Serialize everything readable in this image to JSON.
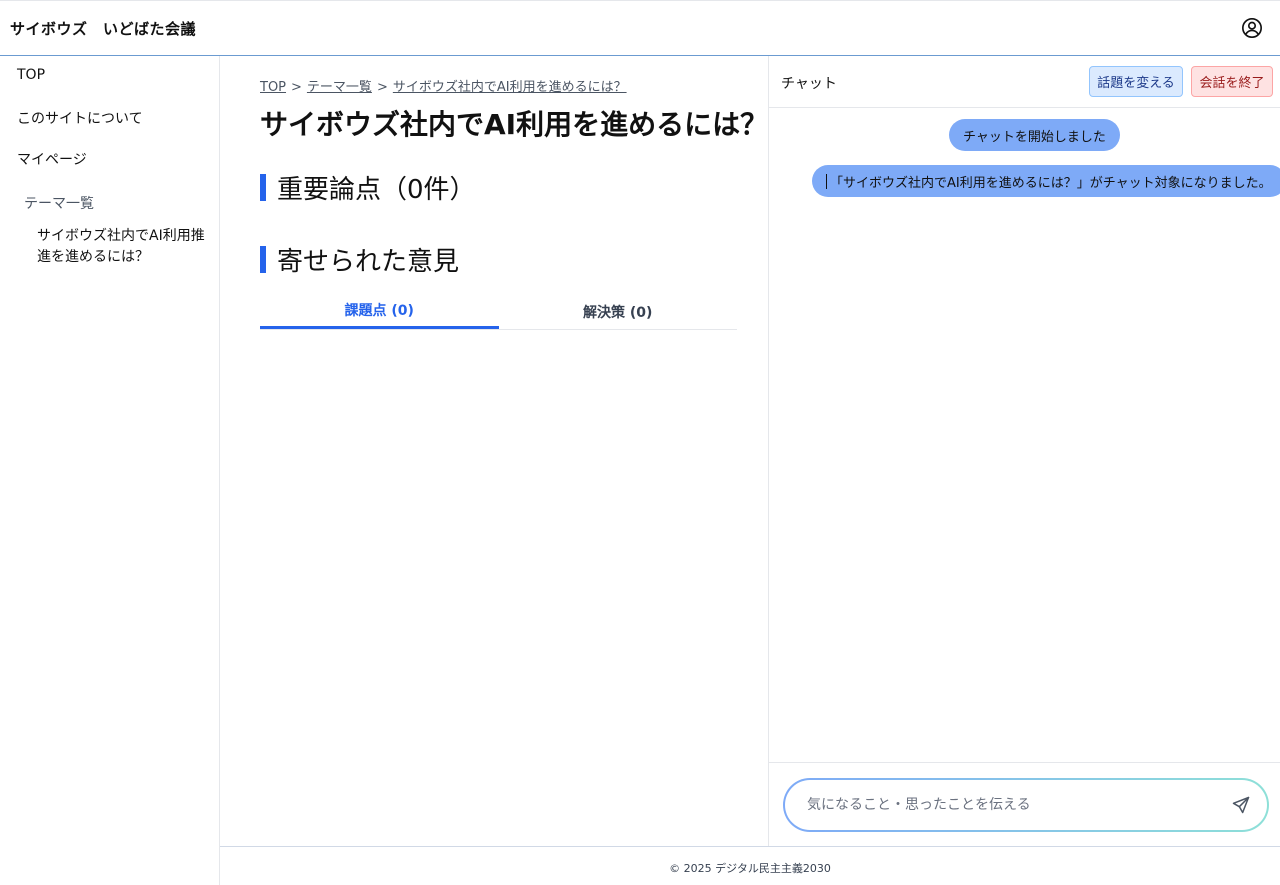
{
  "header": {
    "app_title": "サイボウズ　いどばた会議",
    "account_icon": "user-circle-icon"
  },
  "sidebar": {
    "items": [
      {
        "label": "TOP"
      },
      {
        "label": "このサイトについて"
      },
      {
        "label": "マイページ"
      }
    ],
    "section_label": "テーマ一覧",
    "theme_item": "サイボウズ社内でAI利用推進を進めるには？"
  },
  "main": {
    "breadcrumb": [
      "TOP",
      "テーマ一覧",
      "サイボウズ社内でAI利用を進めるには？"
    ],
    "breadcrumb_sep": ">",
    "title": "サイボウズ社内でAI利用を進めるには？",
    "key_points_heading": "重要論点（0件）",
    "opinions_heading": "寄せられた意見",
    "tabs": [
      {
        "label": "課題点 (0)",
        "active": true
      },
      {
        "label": "解決策 (0)",
        "active": false
      }
    ]
  },
  "chat": {
    "title": "チャット",
    "change_topic_label": "話題を変える",
    "end_label": "会話を終了",
    "messages": [
      "チャットを開始しました",
      "「サイボウズ社内でAI利用を進めるには？」がチャット対象になりました。"
    ],
    "input_placeholder": "気になること・思ったことを伝える",
    "input_value": "",
    "send_icon": "send-icon"
  },
  "footer": {
    "text": "© 2025 デジタル民主主義2030"
  },
  "colors": {
    "accent": "#2563eb",
    "bubble": "#7eaaf7",
    "topic_button_bg": "#dbeafe",
    "end_button_bg": "#fee2e2"
  }
}
